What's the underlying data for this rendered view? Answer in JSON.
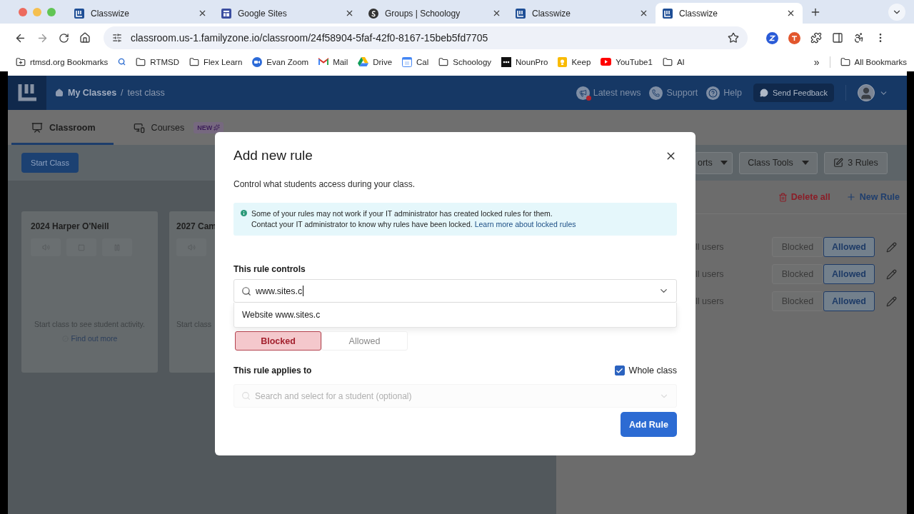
{
  "browser": {
    "tabs": [
      {
        "title": "Classwize",
        "kind": "classwize",
        "selected": false
      },
      {
        "title": "Google Sites",
        "kind": "sites",
        "selected": false
      },
      {
        "title": "Groups | Schoology",
        "kind": "schoology",
        "selected": false
      },
      {
        "title": "Classwize",
        "kind": "classwize",
        "selected": false
      },
      {
        "title": "Classwize",
        "kind": "classwize",
        "selected": true
      }
    ],
    "url": "classroom.us-1.familyzone.io/classroom/24f58904-5faf-42f0-8167-15beb5fd7705",
    "bookmarks": [
      {
        "label": "rtmsd.org Bookmarks",
        "kind": "folder-plus"
      },
      {
        "kind": "search"
      },
      {
        "label": "RTMSD",
        "kind": "folder"
      },
      {
        "label": "Flex Learn",
        "kind": "folder"
      },
      {
        "label": "Evan Zoom",
        "kind": "zoom"
      },
      {
        "label": "Mail",
        "kind": "mail"
      },
      {
        "label": "Drive",
        "kind": "drive"
      },
      {
        "label": "Cal",
        "kind": "cal"
      },
      {
        "label": "Schoology",
        "kind": "folder"
      },
      {
        "label": "NounPro",
        "kind": "nounpro"
      },
      {
        "label": "Keep",
        "kind": "keep"
      },
      {
        "label": "YouTube1",
        "kind": "youtube"
      },
      {
        "label": "AI",
        "kind": "folder"
      }
    ],
    "overflow": "»",
    "all_bookmarks": "All Bookmarks"
  },
  "header": {
    "breadcrumb": [
      "My Classes",
      "test class"
    ],
    "separator": "/",
    "links": [
      {
        "label": "Latest news",
        "kind": "news"
      },
      {
        "label": "Support",
        "kind": "support"
      },
      {
        "label": "Help",
        "kind": "help"
      }
    ],
    "feedback": "Send Feedback"
  },
  "nav_tabs": [
    {
      "label": "Classroom",
      "kind": "classroom",
      "selected": true
    },
    {
      "label": "Courses",
      "kind": "courses",
      "selected": false,
      "badge": "NEW"
    }
  ],
  "start_class": "Start Class",
  "toolbar": {
    "partial_button": "orts",
    "class_tools": "Class Tools",
    "rules": "3 Rules"
  },
  "cards": [
    {
      "title": "2024 Harper O'Neill",
      "message": "Start class to see student activity.",
      "link": "Find out more"
    },
    {
      "title": "2027 Cam",
      "message": "Start class"
    }
  ],
  "rules_panel": {
    "delete_all": "Delete all",
    "new_rule": "New Rule",
    "rows": [
      {
        "target": "ll users",
        "options": [
          {
            "label": "Blocked",
            "selected": false
          },
          {
            "label": "Allowed",
            "selected": true
          }
        ]
      },
      {
        "target": "ll users",
        "options": [
          {
            "label": "Blocked",
            "selected": false
          },
          {
            "label": "Allowed",
            "selected": true
          }
        ]
      },
      {
        "target": "ll users",
        "options": [
          {
            "label": "Blocked",
            "selected": false
          },
          {
            "label": "Allowed",
            "selected": true
          }
        ]
      }
    ]
  },
  "modal": {
    "title": "Add new rule",
    "subtitle": "Control what students access during your class.",
    "info": {
      "line1": "Some of your rules may not work if your IT administrator has created locked rules for them.",
      "line2": "Contact your IT administrator to know why rules have been locked.",
      "link": "Learn more about locked rules"
    },
    "controls_label": "This rule controls",
    "controls_value": "www.sites.c",
    "suggestion": "Website www.sites.c",
    "mode": [
      {
        "label": "Blocked",
        "selected": true
      },
      {
        "label": "Allowed",
        "selected": false
      }
    ],
    "applies_label": "This rule applies to",
    "whole_class": {
      "label": "Whole class",
      "checked": true
    },
    "student_field": {
      "placeholder": "Search and select for a student (optional)",
      "disabled": true
    },
    "submit": "Add Rule"
  }
}
